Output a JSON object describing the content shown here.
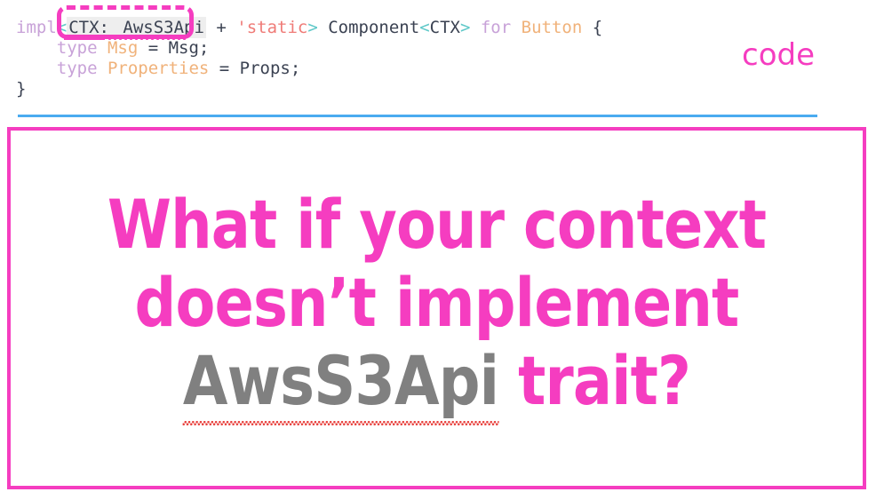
{
  "code": {
    "label": "code",
    "lines": [
      {
        "tokens": [
          {
            "text": "impl",
            "kind": "kw"
          },
          {
            "text": "<",
            "kind": "angle"
          },
          {
            "text": "CTX: ",
            "kind": "plain-hl"
          },
          {
            "text": "AwsS3Api",
            "kind": "plain-hl"
          },
          {
            "text": " + ",
            "kind": "punct"
          },
          {
            "text": "'static",
            "kind": "life"
          },
          {
            "text": ">",
            "kind": "angle"
          },
          {
            "text": " Component",
            "kind": "plain"
          },
          {
            "text": "<",
            "kind": "angle"
          },
          {
            "text": "CTX",
            "kind": "plain"
          },
          {
            "text": ">",
            "kind": "angle"
          },
          {
            "text": " for ",
            "kind": "kw"
          },
          {
            "text": "Button",
            "kind": "type"
          },
          {
            "text": " {",
            "kind": "punct"
          }
        ],
        "plain": "impl<CTX: AwsS3Api + 'static> Component<CTX> for Button {"
      },
      {
        "tokens": [
          {
            "text": "    type ",
            "kind": "kw"
          },
          {
            "text": "Msg",
            "kind": "type"
          },
          {
            "text": " = ",
            "kind": "punct"
          },
          {
            "text": "Msg;",
            "kind": "plain"
          }
        ],
        "plain": "    type Msg = Msg;"
      },
      {
        "tokens": [
          {
            "text": "    type ",
            "kind": "kw"
          },
          {
            "text": "Properties",
            "kind": "type"
          },
          {
            "text": " = ",
            "kind": "punct"
          },
          {
            "text": "Props;",
            "kind": "plain"
          }
        ],
        "plain": "    type Properties = Props;"
      },
      {
        "tokens": [
          {
            "text": "}",
            "kind": "punct"
          }
        ],
        "plain": "}"
      }
    ],
    "annotation": {
      "callout_target": "CTX: AwsS3Api",
      "underline_target": "CTX",
      "squiggle_target": "AwsS3Api"
    }
  },
  "slide": {
    "headline_lines": [
      {
        "text": "What if your context",
        "color": "pink"
      },
      {
        "text": "doesn’t implement",
        "color": "pink"
      },
      {
        "segments": [
          {
            "text": "AwsS3Api",
            "color": "grey",
            "spellcheck_error": true
          },
          {
            "text": " ",
            "color": "grey"
          },
          {
            "text": "trait?",
            "color": "pink"
          }
        ]
      }
    ],
    "headline_plain": "What if your context doesn’t implement AwsS3Api trait?"
  },
  "colors": {
    "accent_pink": "#f53dc0",
    "divider_blue": "#4aabf0",
    "grey_text": "#808080",
    "spell_error_red": "#e8413d",
    "code_keyword": "#c8a2d8",
    "code_angle": "#5ec8c8",
    "code_lifetime": "#ef7b77",
    "code_type": "#f0b27a",
    "code_plain": "#3b4252",
    "highlight_bg": "#eeeeee"
  }
}
